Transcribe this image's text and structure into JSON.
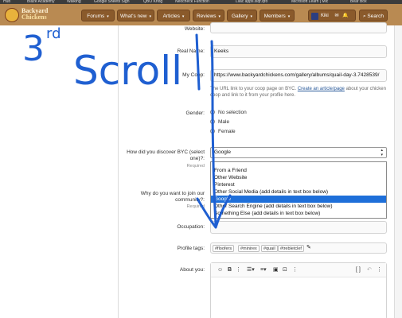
{
  "browser": {
    "bookmarks": [
      "Hub",
      "Blaze Academy",
      "Walking",
      "Google Sheets Sign",
      "QBO Knog",
      "Neocheck Function",
      "Lilac apps.isqr.qro",
      "Microsoft Learn | Mic",
      "Bear Box"
    ]
  },
  "site": {
    "logo_line1": "Backyard",
    "logo_line2": "Chickens",
    "nav": [
      "Forums",
      "What's new",
      "Articles",
      "Reviews",
      "Gallery",
      "Members"
    ],
    "user_name": "Kiki",
    "search_label": "Search",
    "colors": {
      "nav_bg": "#b98a52",
      "nav_button": "#8a5a2b",
      "accent_select": "#1e6fd9",
      "ink": "#1f5fd1"
    }
  },
  "form": {
    "website": {
      "label": "Website:",
      "value": ""
    },
    "real_name": {
      "label": "Real Name:",
      "value": "Keeks"
    },
    "my_coop": {
      "label": "My Coop:",
      "value": "https://www.backyardchickens.com/gallery/albums/quail-day-3.7428539/",
      "hint_before": "The URL link to your coop page on BYC.",
      "hint_link": "Create an article/page",
      "hint_after": "about your chicken coop and link to it from your profile here."
    },
    "gender": {
      "label": "Gender:",
      "options": [
        "No selection",
        "Male",
        "Female"
      ],
      "selected": "Female"
    },
    "discover": {
      "label_line1": "How did you discover BYC (select",
      "label_line2": "one)?:",
      "required": "Required",
      "value": "Google",
      "options": [
        "From a Friend",
        "Other Website",
        "Pinterest",
        "Other Social Media (add details in text box below)",
        "Google",
        "Other Search Engine (add details in text box below)",
        "Something Else (add details in text box below)"
      ]
    },
    "join": {
      "label_line1": "Why do you want to join our",
      "label_line2": "community?:",
      "required": "Required"
    },
    "occupation": {
      "label": "Occupation:"
    },
    "profile_tags": {
      "label": "Profile tags:",
      "tags": [
        "#floofers",
        "#minirex",
        "#quail",
        "#trebletclef"
      ]
    },
    "about": {
      "label": "About you:"
    }
  },
  "annotation": {
    "text_3": "3",
    "text_rd": "rd",
    "text_scroll": "Scroll"
  }
}
